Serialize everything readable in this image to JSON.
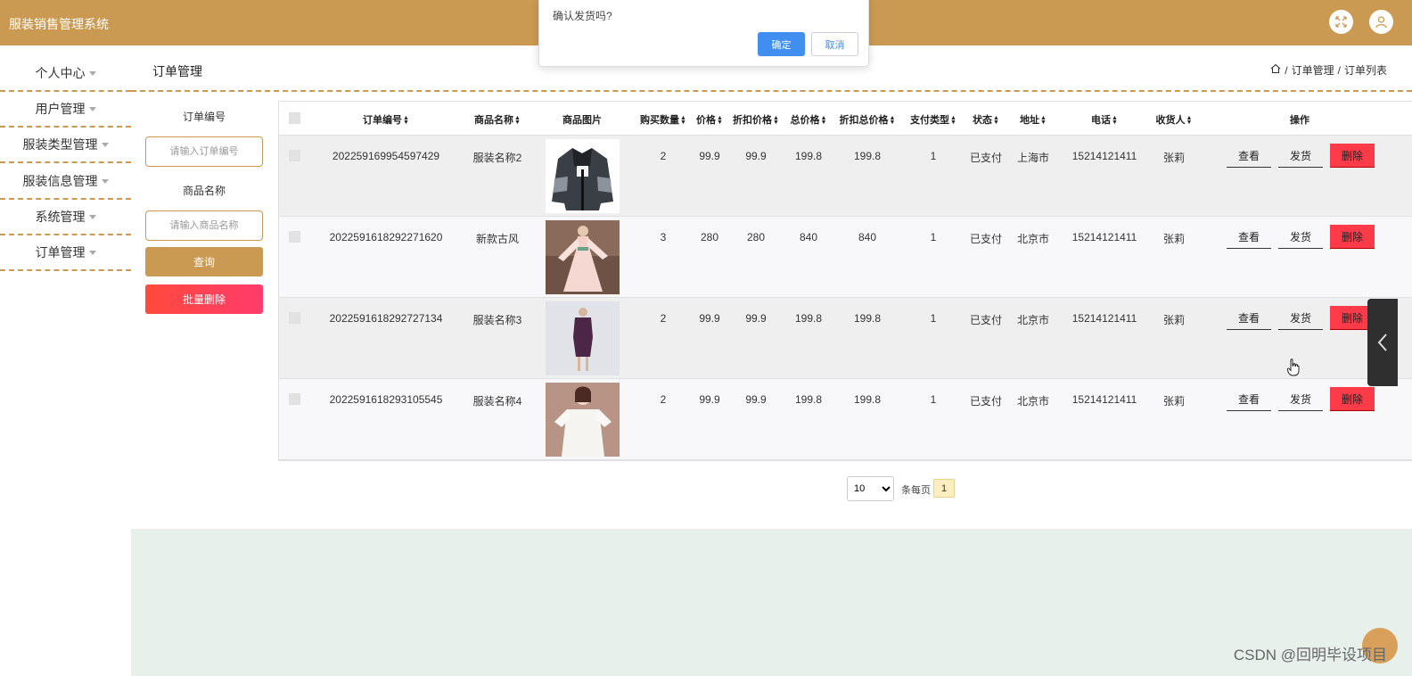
{
  "app": {
    "title": "服装销售管理系统"
  },
  "header": {
    "fullscreen_icon": "fullscreen-icon",
    "user_icon": "user-icon"
  },
  "sidebar": {
    "items": [
      {
        "label": "个人中心"
      },
      {
        "label": "用户管理"
      },
      {
        "label": "服装类型管理"
      },
      {
        "label": "服装信息管理"
      },
      {
        "label": "系统管理"
      },
      {
        "label": "订单管理"
      }
    ]
  },
  "page": {
    "title": "订单管理"
  },
  "breadcrumb": {
    "home_icon": "home-icon",
    "sep": "/",
    "level1": "订单管理",
    "level2": "订单列表"
  },
  "filter": {
    "order_no_label": "订单编号",
    "order_no_placeholder": "请输入订单编号",
    "product_name_label": "商品名称",
    "product_name_placeholder": "请输入商品名称",
    "query_button": "查询",
    "batch_delete_button": "批量删除"
  },
  "table": {
    "columns": [
      "订单编号",
      "商品名称",
      "商品图片",
      "购买数量",
      "价格",
      "折扣价格",
      "总价格",
      "折扣总价格",
      "支付类型",
      "状态",
      "地址",
      "电话",
      "收货人",
      "操作"
    ],
    "rows": [
      {
        "order_no": "202259169954597429",
        "product_name": "服装名称2",
        "quantity": "2",
        "price": "99.9",
        "discount_price": "99.9",
        "total": "199.8",
        "discount_total": "199.8",
        "pay_type": "1",
        "status": "已支付",
        "address": "上海市",
        "phone": "15214121411",
        "receiver": "张莉"
      },
      {
        "order_no": "2022591618292271620",
        "product_name": "新款古风",
        "quantity": "3",
        "price": "280",
        "discount_price": "280",
        "total": "840",
        "discount_total": "840",
        "pay_type": "1",
        "status": "已支付",
        "address": "北京市",
        "phone": "15214121411",
        "receiver": "张莉"
      },
      {
        "order_no": "2022591618292727134",
        "product_name": "服装名称3",
        "quantity": "2",
        "price": "99.9",
        "discount_price": "99.9",
        "total": "199.8",
        "discount_total": "199.8",
        "pay_type": "1",
        "status": "已支付",
        "address": "北京市",
        "phone": "15214121411",
        "receiver": "张莉"
      },
      {
        "order_no": "2022591618293105545",
        "product_name": "服装名称4",
        "quantity": "2",
        "price": "99.9",
        "discount_price": "99.9",
        "total": "199.8",
        "discount_total": "199.8",
        "pay_type": "1",
        "status": "已支付",
        "address": "北京市",
        "phone": "15214121411",
        "receiver": "张莉"
      }
    ],
    "actions": {
      "view": "查看",
      "ship": "发货",
      "delete": "删除"
    }
  },
  "pagination": {
    "page_size": "10",
    "per_page_label": "条每页",
    "current_page": "1"
  },
  "dialog": {
    "message": "确认发货吗?",
    "ok": "确定",
    "cancel": "取消"
  },
  "watermark": "CSDN @回明毕设项目",
  "colors": {
    "brand": "#cb9a52",
    "danger": "#ff3b4a",
    "primary": "#3f8ef0"
  }
}
